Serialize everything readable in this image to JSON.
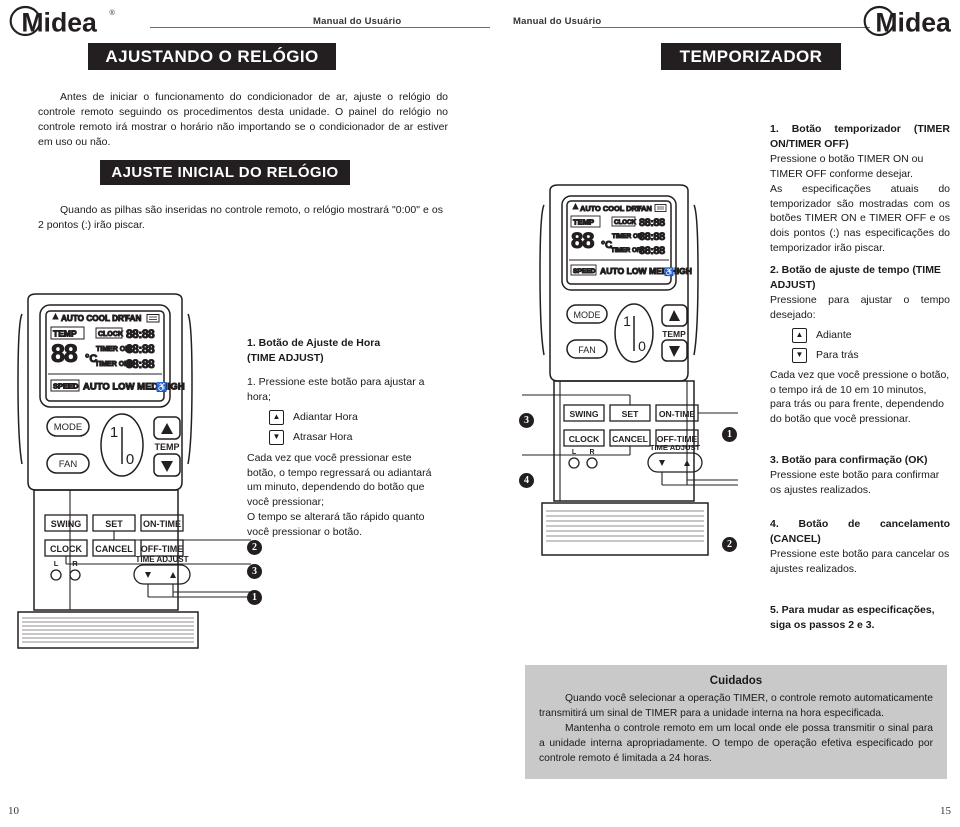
{
  "header": {
    "manual_label_left": "Manual do Usuário",
    "manual_label_right": "Manual do Usuário",
    "logo_text": "Midea",
    "logo_reg": "®"
  },
  "left_page": {
    "banner_title": "AJUSTANDO O RELÓGIO",
    "intro_paragraph": "Antes de iniciar o funcionamento do condicionador de ar, ajuste o relógio do controle remoto seguindo os procedimentos desta unidade. O painel do relógio no controle remoto irá mostrar o horário não importando se o condicionador de ar estiver em uso ou não.",
    "subbanner_title": "AJUSTE INICIAL DO RELÓGIO",
    "second_paragraph": "Quando as pilhas são inseridas no controle remoto, o relógio mostrará \"0:00\" e os 2 pontos (:) irão piscar.",
    "section": {
      "heading_line1": "1. Botão de Ajuste de Hora",
      "heading_line2": "(TIME ADJUST)",
      "step1": "1. Pressione este botão para ajustar  a hora;",
      "key_up_label": "Adiantar Hora",
      "key_down_label": "Atrasar Hora",
      "body": "Cada vez que você pressionar este botão, o tempo regressará ou adiantará um minuto, dependendo do botão que você pressionar;",
      "body2": "O tempo se alterará tão rápido quanto você pressionar o botão."
    },
    "callouts": [
      "1",
      "2",
      "3"
    ],
    "page_number": "10"
  },
  "right_page": {
    "banner_title": "TEMPORIZADOR",
    "callouts": [
      "1",
      "2",
      "3",
      "4"
    ],
    "sections": [
      {
        "heading": "1. Botão temporizador (TIMER ON/TIMER OFF)",
        "body": "Pressione o botão TIMER ON ou TIMER OFF  conforme desejar.",
        "body2": "As especificações atuais do temporizador são mostradas com os botões TIMER ON e TIMER OFF e os dois pontos (:) nas especificações do temporizador irão piscar."
      },
      {
        "heading": "2. Botão de ajuste de tempo (TIME ADJUST)",
        "body": "Pressione para ajustar o tempo desejado:",
        "key_up_label": "Adiante",
        "key_down_label": "Para trás",
        "body2": "Cada vez que você pressione o botão, o tempo irá de 10 em 10 minutos, para trás ou para frente, dependendo do botão que você pressionar."
      },
      {
        "heading": "3. Botão para confirmação (OK)",
        "body": "Pressione este botão para confirmar os ajustes realizados."
      },
      {
        "heading": "4. Botão de cancelamento (CANCEL)",
        "body": "Pressione este botão para cancelar os ajustes realizados."
      },
      {
        "heading": "5. Para mudar as especificações, siga os passos 2 e 3."
      }
    ],
    "cuidados": {
      "title": "Cuidados",
      "paragraph1": "Quando você selecionar a operação TIMER, o controle remoto automaticamente transmitirá um sinal de TIMER para a unidade interna na hora especificada.",
      "paragraph2": "Mantenha o controle remoto em um local onde ele possa transmitir o sinal para a unidade interna apropriadamente. O tempo de operação efetiva especificado por controle remoto é limitada a 24 horas."
    },
    "page_number": "15"
  },
  "remote": {
    "lcd": {
      "mode_row": [
        "AUTO",
        "COOL",
        "DRY"
      ],
      "fan_label": "FAN",
      "temp_label": "TEMP",
      "temp_value": "88",
      "temp_unit": "°C",
      "rows": [
        {
          "label": "CLOCK",
          "value": "88:88"
        },
        {
          "label": "TIMER ON",
          "value": "88:88"
        },
        {
          "label": "TIMER OFF",
          "value": "88:88"
        }
      ],
      "speed_label": "SPEED",
      "speed_options": [
        "AUTO",
        "LOW",
        "MED",
        "HIGH"
      ]
    },
    "buttons_upper": {
      "mode": "MODE",
      "fan": "FAN",
      "power_top": "1",
      "power_bottom": "0",
      "temp": "TEMP"
    },
    "buttons_lower": [
      [
        "SWING",
        "SET",
        "ON-TIME"
      ],
      [
        "CLOCK",
        "CANCEL",
        "OFF-TIME"
      ]
    ],
    "led_labels": [
      "L",
      "R"
    ],
    "time_adjust_label": "TIME ADJUST"
  },
  "colors": {
    "banner_bg": "#231f20",
    "cuidados_bg": "#c9c9c9",
    "line": "#6b6b6b"
  }
}
